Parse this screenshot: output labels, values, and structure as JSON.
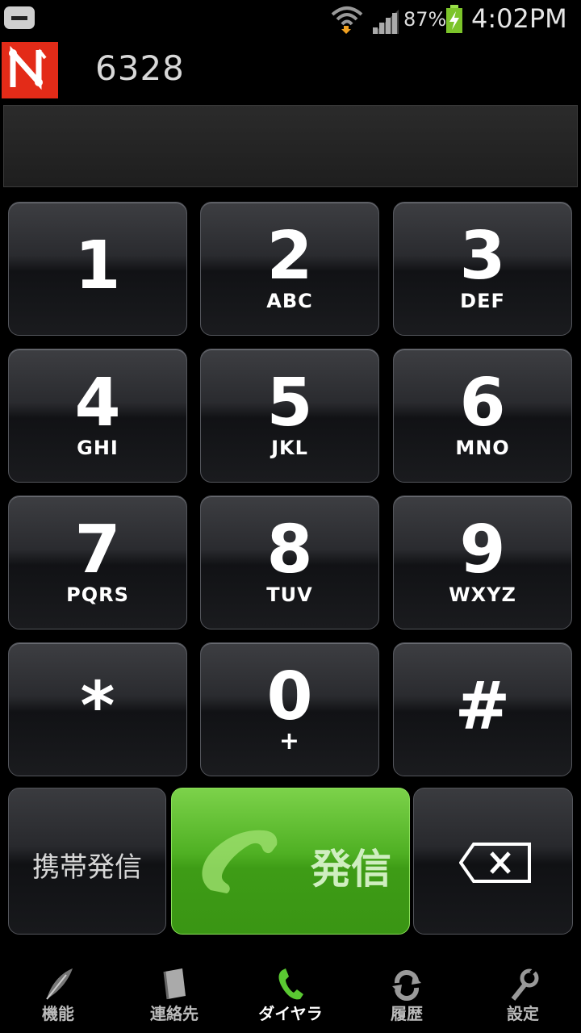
{
  "status_bar": {
    "battery_percent": "87%",
    "time": "4:02PM"
  },
  "header": {
    "dialed_number": "6328"
  },
  "keypad": [
    {
      "digit": "1",
      "letters": ""
    },
    {
      "digit": "2",
      "letters": "ABC"
    },
    {
      "digit": "3",
      "letters": "DEF"
    },
    {
      "digit": "4",
      "letters": "GHI"
    },
    {
      "digit": "5",
      "letters": "JKL"
    },
    {
      "digit": "6",
      "letters": "MNO"
    },
    {
      "digit": "7",
      "letters": "PQRS"
    },
    {
      "digit": "8",
      "letters": "TUV"
    },
    {
      "digit": "9",
      "letters": "WXYZ"
    },
    {
      "digit": "*",
      "letters": ""
    },
    {
      "digit": "0",
      "letters": "+"
    },
    {
      "digit": "#",
      "letters": ""
    }
  ],
  "actions": {
    "mobile_call_label": "携帯発信",
    "call_label": "発信",
    "backspace_icon": "backspace-icon"
  },
  "nav": [
    {
      "label": "機能",
      "icon": "feather-icon",
      "active": false
    },
    {
      "label": "連絡先",
      "icon": "book-icon",
      "active": false
    },
    {
      "label": "ダイヤラ",
      "icon": "phone-icon",
      "active": true
    },
    {
      "label": "履歴",
      "icon": "history-icon",
      "active": false
    },
    {
      "label": "設定",
      "icon": "wrench-icon",
      "active": false
    }
  ],
  "colors": {
    "call_green": "#4fb023",
    "logo_red": "#e32b18"
  }
}
